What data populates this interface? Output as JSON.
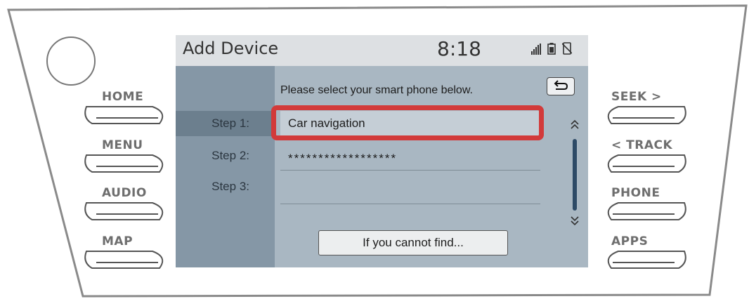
{
  "screen": {
    "title": "Add Device",
    "clock": "8:18",
    "status_icons": [
      "signal-icon",
      "battery-icon",
      "no-phone-icon"
    ]
  },
  "steps": [
    {
      "label": "Step 1:",
      "active": true
    },
    {
      "label": "Step 2:",
      "active": false
    },
    {
      "label": "Step 3:",
      "active": false
    }
  ],
  "content": {
    "instruction": "Please select your smart phone below.",
    "fields": [
      "Car navigation",
      "******************",
      ""
    ],
    "find_button": "If you cannot find..."
  },
  "hardware": {
    "left": [
      "HOME",
      "MENU",
      "AUDIO",
      "MAP"
    ],
    "right": [
      "SEEK >",
      "< TRACK",
      "PHONE",
      "APPS"
    ]
  },
  "colors": {
    "highlight": "#d23a3a",
    "screen_bg": "#a9b7c2",
    "scrollbar": "#2d4a66"
  }
}
